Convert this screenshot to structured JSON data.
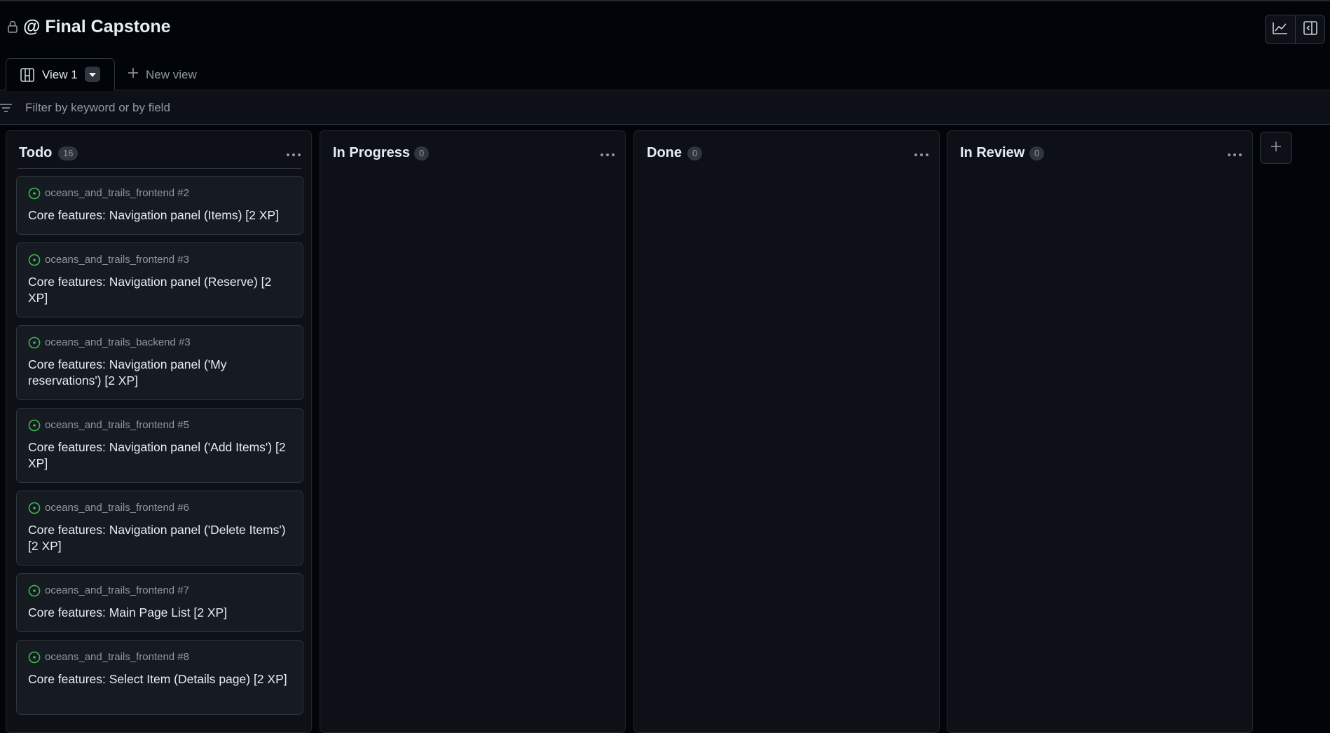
{
  "project": {
    "title": "@ Final Capstone"
  },
  "header_actions": {
    "insights_icon": "graph-icon",
    "sidepanel_icon": "sidebar-expand-icon"
  },
  "tabs": {
    "active_label": "View 1",
    "new_view_label": "New view"
  },
  "filter": {
    "placeholder": "Filter by keyword or by field",
    "value": ""
  },
  "columns": [
    {
      "name": "Todo",
      "count": "16"
    },
    {
      "name": "In Progress",
      "count": "0"
    },
    {
      "name": "Done",
      "count": "0"
    },
    {
      "name": "In Review",
      "count": "0"
    }
  ],
  "cards": [
    {
      "repo": "oceans_and_trails_frontend #2",
      "title": "Core features: Navigation panel (Items) [2 XP]"
    },
    {
      "repo": "oceans_and_trails_frontend #3",
      "title": "Core features: Navigation panel (Reserve) [2 XP]"
    },
    {
      "repo": "oceans_and_trails_backend #3",
      "title": "Core features: Navigation panel ('My reservations') [2 XP]"
    },
    {
      "repo": "oceans_and_trails_frontend #5",
      "title": "Core features: Navigation panel ('Add Items') [2 XP]"
    },
    {
      "repo": "oceans_and_trails_frontend #6",
      "title": "Core features: Navigation panel ('Delete Items') [2 XP]"
    },
    {
      "repo": "oceans_and_trails_frontend #7",
      "title": "Core features: Main Page List [2 XP]"
    },
    {
      "repo": "oceans_and_trails_frontend #8",
      "title": "Core features: Select Item (Details page) [2 XP]"
    }
  ],
  "colors": {
    "background": "#010409",
    "column_bg": "#0d1117",
    "card_bg": "#161b22",
    "border": "#30363d",
    "open_issue_green": "#3fb950",
    "muted_text": "#9198a1"
  }
}
